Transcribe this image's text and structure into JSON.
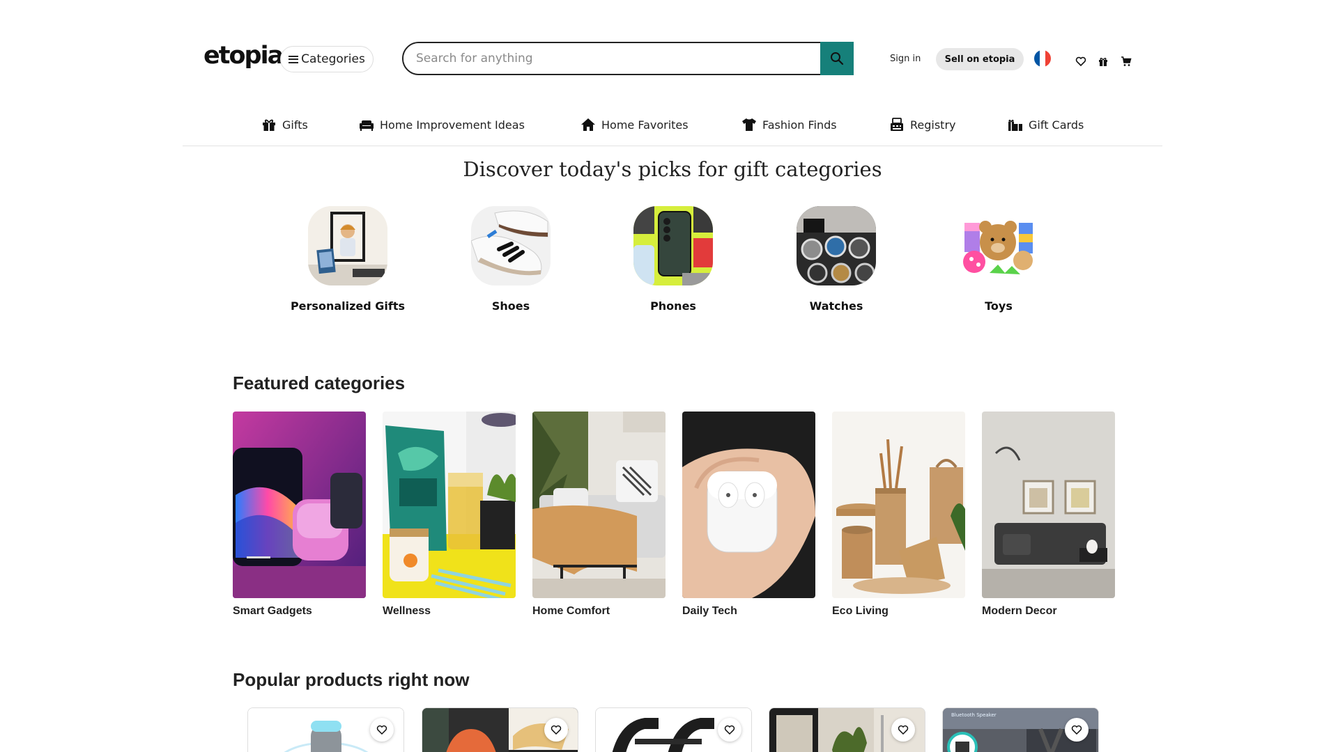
{
  "header": {
    "logo": "etopia",
    "categories_label": "Categories",
    "search_placeholder": "Search for anything",
    "sign_in": "Sign in",
    "sell": "Sell on etopia",
    "flag_colors": [
      "#0055a4",
      "#ffffff",
      "#ef4135"
    ]
  },
  "nav": {
    "items": [
      {
        "label": "Gifts",
        "icon": "gift-icon"
      },
      {
        "label": "Home Improvement Ideas",
        "icon": "sofa-icon"
      },
      {
        "label": "Home Favorites",
        "icon": "house-icon"
      },
      {
        "label": "Fashion Finds",
        "icon": "shirt-icon"
      },
      {
        "label": "Registry",
        "icon": "registry-icon"
      },
      {
        "label": "Gift Cards",
        "icon": "gift-card-icon"
      }
    ]
  },
  "discover": {
    "title": "Discover today's picks for gift categories",
    "items": [
      {
        "label": "Personalized Gifts"
      },
      {
        "label": "Shoes"
      },
      {
        "label": "Phones"
      },
      {
        "label": "Watches"
      },
      {
        "label": "Toys"
      }
    ]
  },
  "featured": {
    "title": "Featured categories",
    "items": [
      {
        "label": "Smart Gadgets"
      },
      {
        "label": "Wellness"
      },
      {
        "label": "Home Comfort"
      },
      {
        "label": "Daily Tech"
      },
      {
        "label": "Eco Living"
      },
      {
        "label": "Modern Decor"
      }
    ]
  },
  "popular": {
    "title": "Popular products right now",
    "items": [
      {
        "name": "smart-speaker-product"
      },
      {
        "name": "shoe-insert-product"
      },
      {
        "name": "pushup-bars-product"
      },
      {
        "name": "room-decor-product"
      },
      {
        "name": "bluetooth-speaker-product",
        "badge": "Bluetooth Speaker"
      }
    ]
  },
  "colors": {
    "accent": "#16807a",
    "sell_bg": "#e7e7e7"
  }
}
